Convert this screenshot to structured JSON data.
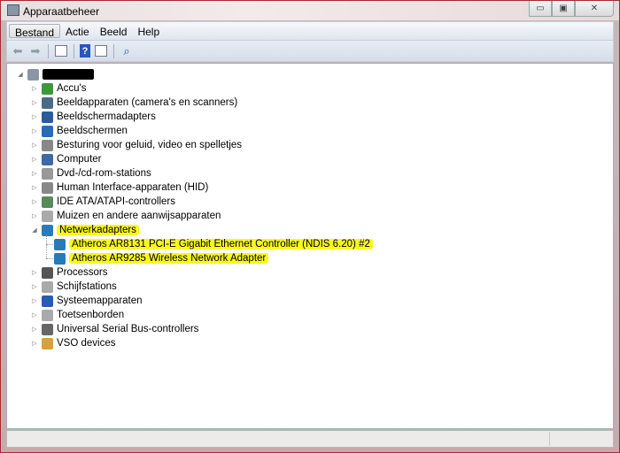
{
  "window": {
    "title": "Apparaatbeheer",
    "controls": [
      "minimize",
      "maximize",
      "close"
    ]
  },
  "menu": [
    "Bestand",
    "Actie",
    "Beeld",
    "Help"
  ],
  "toolbar": [
    "back-icon",
    "forward-icon",
    "properties-icon",
    "help-icon",
    "pane-icon",
    "scan-hardware-icon"
  ],
  "tree": {
    "root": "",
    "categories": [
      {
        "label": "Accu's",
        "icon": "battery-icon",
        "color": "#3a9a3a"
      },
      {
        "label": "Beeldapparaten (camera's en scanners)",
        "icon": "camera-icon",
        "color": "#4a6a8a"
      },
      {
        "label": "Beeldschermadapters",
        "icon": "display-adapter-icon",
        "color": "#2a5a9a"
      },
      {
        "label": "Beeldschermen",
        "icon": "monitor-icon",
        "color": "#2a6ab8"
      },
      {
        "label": "Besturing voor geluid, video en spelletjes",
        "icon": "speaker-icon",
        "color": "#888888"
      },
      {
        "label": "Computer",
        "icon": "computer-icon",
        "color": "#3a6aa8"
      },
      {
        "label": "Dvd-/cd-rom-stations",
        "icon": "dvd-icon",
        "color": "#999999"
      },
      {
        "label": "Human Interface-apparaten (HID)",
        "icon": "hid-icon",
        "color": "#888888"
      },
      {
        "label": "IDE ATA/ATAPI-controllers",
        "icon": "ide-icon",
        "color": "#5a8a5a"
      },
      {
        "label": "Muizen en andere aanwijsapparaten",
        "icon": "mouse-icon",
        "color": "#aaaaaa"
      },
      {
        "label": "Netwerkadapters",
        "icon": "network-icon",
        "color": "#2a7ab8",
        "expanded": true,
        "highlighted": true,
        "children": [
          "Atheros AR8131 PCI-E Gigabit Ethernet Controller (NDIS 6.20) #2",
          "Atheros AR9285 Wireless Network Adapter"
        ]
      },
      {
        "label": "Processors",
        "icon": "processor-icon",
        "color": "#555555"
      },
      {
        "label": "Schijfstations",
        "icon": "disk-icon",
        "color": "#aaaaaa"
      },
      {
        "label": "Systeemapparaten",
        "icon": "system-icon",
        "color": "#2a5ab8"
      },
      {
        "label": "Toetsenborden",
        "icon": "keyboard-icon",
        "color": "#aaaaaa"
      },
      {
        "label": "Universal Serial Bus-controllers",
        "icon": "usb-icon",
        "color": "#666666"
      },
      {
        "label": "VSO devices",
        "icon": "vso-icon",
        "color": "#d8a040"
      }
    ]
  },
  "highlight_color": "#f8f81e"
}
